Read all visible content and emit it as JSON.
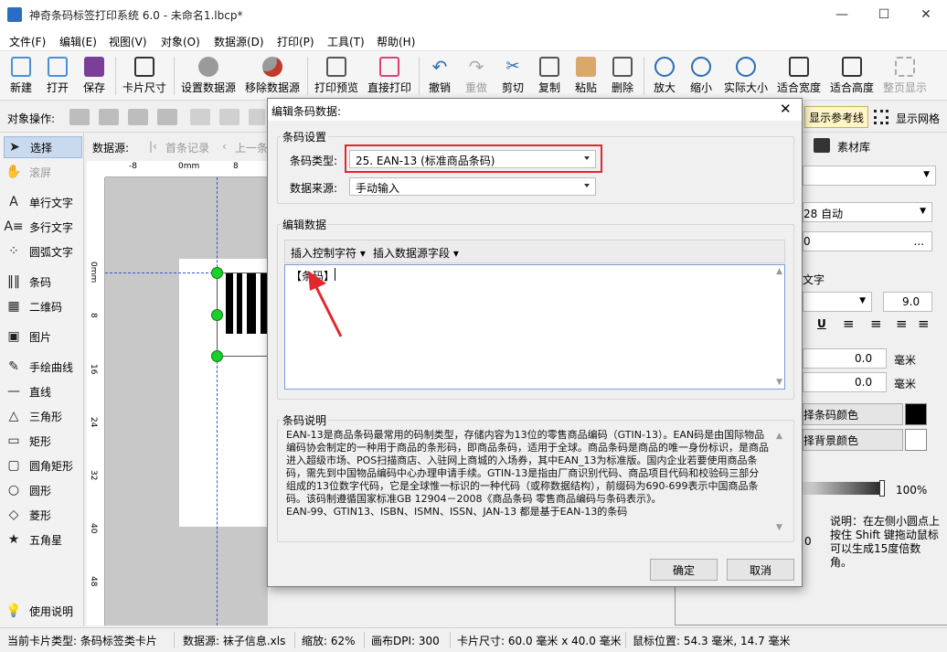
{
  "window": {
    "title": "神奇条码标签打印系统 6.0 - 未命名1.lbcp*"
  },
  "menu": [
    "文件(F)",
    "编辑(E)",
    "视图(V)",
    "对象(O)",
    "数据源(D)",
    "打印(P)",
    "工具(T)",
    "帮助(H)"
  ],
  "toolbar": [
    {
      "label": "新建",
      "icon": "new-file-icon",
      "color": "#4a90d9"
    },
    {
      "label": "打开",
      "icon": "open-icon",
      "color": "#4a90d9"
    },
    {
      "label": "保存",
      "icon": "save-icon",
      "color": "#7b3f98"
    },
    {
      "label": "卡片尺寸",
      "icon": "card-size-icon",
      "color": "#333333"
    },
    {
      "label": "设置数据源",
      "icon": "database-settings-icon",
      "color": "#777777"
    },
    {
      "label": "移除数据源",
      "icon": "database-remove-icon",
      "color": "#c0392b"
    },
    {
      "label": "打印预览",
      "icon": "print-preview-icon",
      "color": "#555555"
    },
    {
      "label": "直接打印",
      "icon": "print-icon",
      "color": "#e0407b"
    },
    {
      "label": "撤销",
      "icon": "undo-icon",
      "color": "#2a6db5"
    },
    {
      "label": "重做",
      "icon": "redo-icon",
      "color": "#aaaaaa"
    },
    {
      "label": "剪切",
      "icon": "cut-icon",
      "color": "#2a6db5"
    },
    {
      "label": "复制",
      "icon": "copy-icon",
      "color": "#555555"
    },
    {
      "label": "粘贴",
      "icon": "paste-icon",
      "color": "#b57b3a"
    },
    {
      "label": "删除",
      "icon": "delete-icon",
      "color": "#555555"
    },
    {
      "label": "放大",
      "icon": "zoom-in-icon",
      "color": "#2a6db5"
    },
    {
      "label": "缩小",
      "icon": "zoom-out-icon",
      "color": "#2a6db5"
    },
    {
      "label": "实际大小",
      "icon": "actual-size-icon",
      "color": "#2a6db5"
    },
    {
      "label": "适合宽度",
      "icon": "fit-width-icon",
      "color": "#333333"
    },
    {
      "label": "适合高度",
      "icon": "fit-height-icon",
      "color": "#333333"
    },
    {
      "label": "整页显示",
      "icon": "full-page-icon",
      "color": "#aaaaaa"
    }
  ],
  "object_ops": {
    "label": "对象操作:",
    "show_guides": "显示参考线",
    "show_grid": "显示网格"
  },
  "datasource_bar": {
    "label": "数据源:",
    "first": "首条记录",
    "prev": "上一条"
  },
  "tools": [
    "选择",
    "滚屏",
    "单行文字",
    "多行文字",
    "圆弧文字",
    "条码",
    "二维码",
    "图片",
    "手绘曲线",
    "直线",
    "三角形",
    "矩形",
    "圆角矩形",
    "圆形",
    "菱形",
    "五角星",
    "使用说明"
  ],
  "ruler_top": [
    "-8",
    "0mm",
    "8"
  ],
  "ruler_left": [
    "0mm",
    "8",
    "16",
    "24",
    "32",
    "40",
    "48"
  ],
  "right_panel": {
    "tab": "素材库",
    "font_size": "28 自动",
    "value_0": "0",
    "text_label": "文字",
    "font_pt": "9.0",
    "offset1": "0.0",
    "unit1": "毫米",
    "offset2": "0.0",
    "unit2": "毫米",
    "barcode_color": "择条码颜色",
    "bg_color": "择背景颜色",
    "opacity": "100%",
    "hint": "说明：在左侧小圆点上按住 Shift 键拖动鼠标可以生成15度倍数角。",
    "zero": "0"
  },
  "dialog": {
    "title": "编辑条码数据:",
    "settings_group": "条码设置",
    "type_label": "条码类型:",
    "type_value": "25.  EAN-13 (标准商品条码)",
    "source_label": "数据来源:",
    "source_value": "手动输入",
    "edit_group": "编辑数据",
    "insert_ctrl": "插入控制字符",
    "insert_field": "插入数据源字段",
    "editor_text": "【条码】",
    "desc_group": "条码说明",
    "description": "EAN-13是商品条码最常用的码制类型，存储内容为13位的零售商品编码（GTIN-13）。EAN码是由国际物品编码协会制定的一种用于商品的条形码，即商品条码，适用于全球。商品条码是商品的唯一身份标识，是商品进入超级市场、POS扫描商店、入驻网上商城的入场券，其中EAN_13为标准版。国内企业若要使用商品条码，需先到中国物品编码中心办理申请手续。GTIN-13是指由厂商识别代码、商品项目代码和校验码三部分组成的13位数字代码，它是全球惟一标识的一种代码（或称数据结构），前缀码为690-699表示中国商品条码。该码制遵循国家标准GB 12904－2008《商品条码 零售商品编码与条码表示》。",
    "description2": "EAN-99、GTIN13、ISBN、ISMN、ISSN、JAN-13 都是基于EAN-13的条码",
    "ok": "确定",
    "cancel": "取消",
    "highlight_color": "#e0282e"
  },
  "status": {
    "card_type": "当前卡片类型:  条码标签类卡片",
    "datasource": "数据源:  袜子信息.xls",
    "zoom": "缩放:  62%",
    "dpi": "画布DPI:  300",
    "card_size": "卡片尺寸:  60.0 毫米 x 40.0 毫米",
    "mouse": "鼠标位置:  54.3 毫米,  14.7 毫米"
  }
}
